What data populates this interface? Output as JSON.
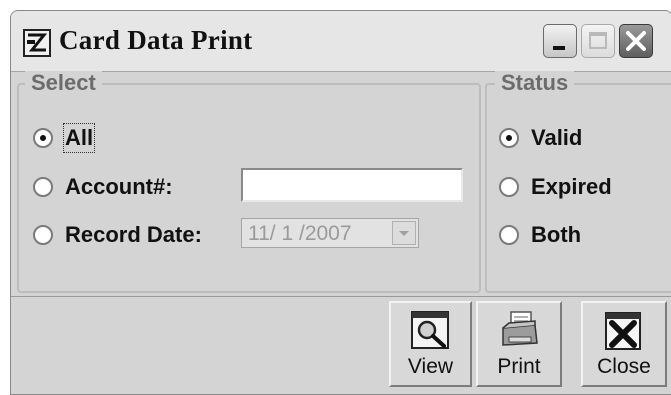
{
  "window": {
    "title": "Card Data Print",
    "controls": [
      "minimize",
      "maximize",
      "close"
    ]
  },
  "select_group": {
    "title": "Select",
    "options": [
      {
        "label": "All",
        "checked": true
      },
      {
        "label": "Account#:",
        "checked": false
      },
      {
        "label": "Record Date:",
        "checked": false
      }
    ],
    "account_input": {
      "value": ""
    },
    "record_date": {
      "value": "11/ 1 /2007",
      "disabled": true
    }
  },
  "status_group": {
    "title": "Status",
    "options": [
      {
        "label": "Valid",
        "checked": true
      },
      {
        "label": "Expired",
        "checked": false
      },
      {
        "label": "Both",
        "checked": false
      }
    ]
  },
  "toolbar": {
    "view_label": "View",
    "print_label": "Print",
    "close_label": "Close"
  },
  "icons": {
    "app": "app-icon",
    "view": "magnifier-icon",
    "print": "printer-icon",
    "close": "close-x-icon"
  }
}
